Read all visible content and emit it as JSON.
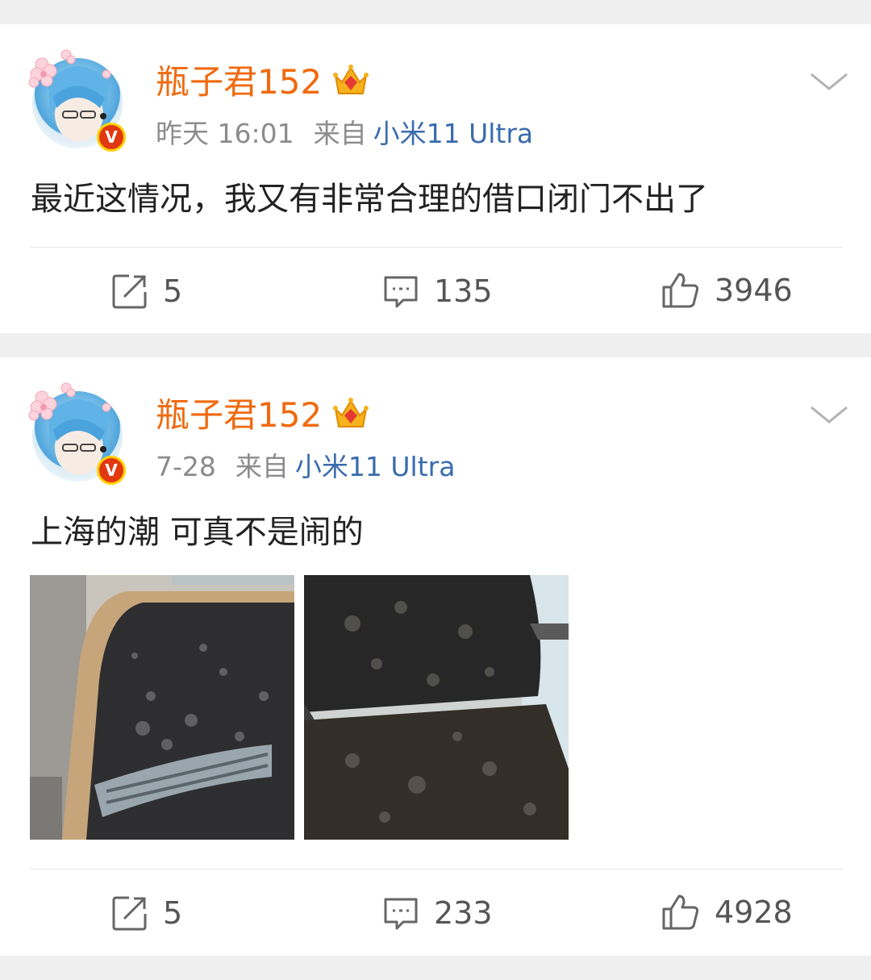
{
  "posts": [
    {
      "username": "瓶子君152",
      "time": "昨天 16:01",
      "from_label": "来自",
      "device": "小米11 Ultra",
      "text": "最近这情况，我又有非常合理的借口闭门不出了",
      "repost_count": "5",
      "comment_count": "135",
      "like_count": "3946"
    },
    {
      "username": "瓶子君152",
      "time": "7-28",
      "from_label": "来自",
      "device": "小米11 Ultra",
      "text": "上海的潮 可真不是闹的",
      "repost_count": "5",
      "comment_count": "233",
      "like_count": "4928",
      "photos": [
        "moldy-chair-back-photo",
        "moldy-chair-seat-photo"
      ]
    }
  ],
  "icons": {
    "verified_badge": "V",
    "repost": "repost-icon",
    "comment": "comment-icon",
    "like": "thumbs-up-icon",
    "menu": "chevron-down-icon"
  },
  "colors": {
    "username": "#f06a0f",
    "device": "#3a6cad",
    "meta": "#8c8c8c",
    "background": "#efefef"
  }
}
